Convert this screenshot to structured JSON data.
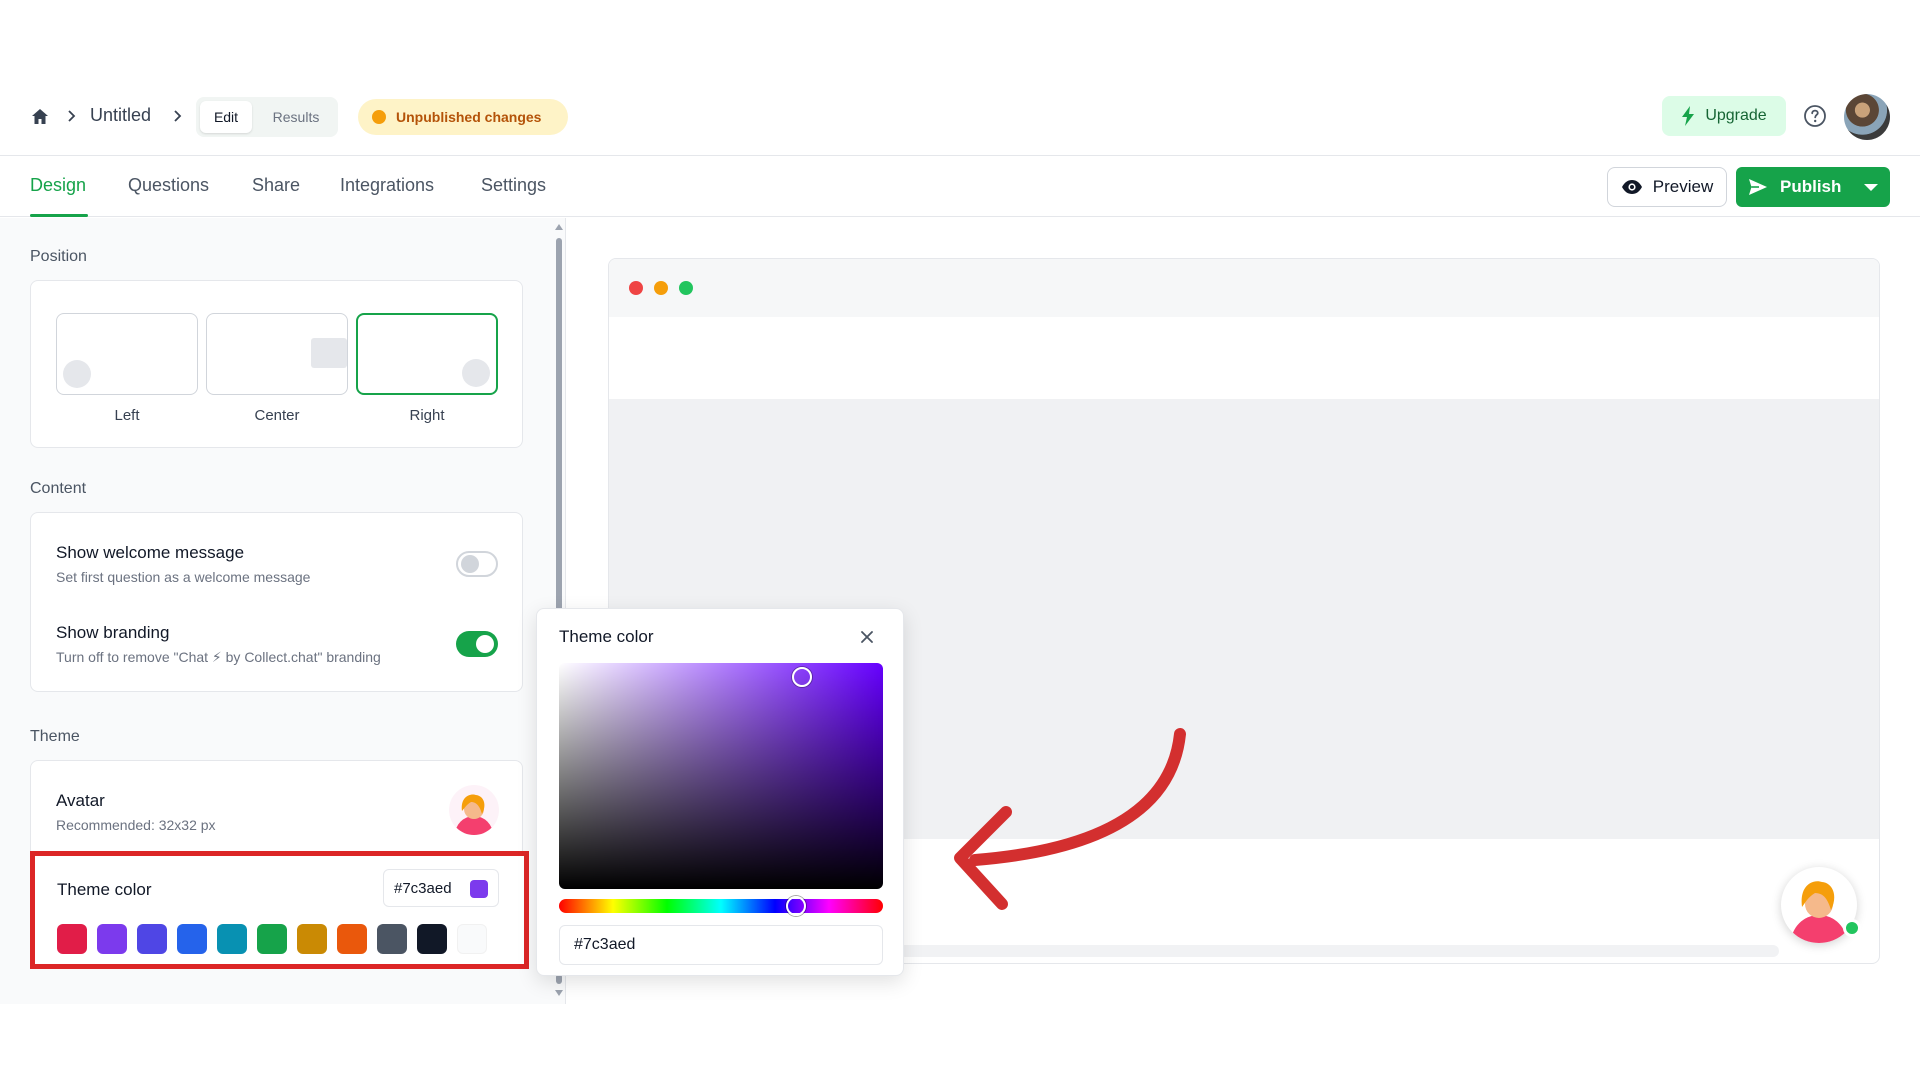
{
  "header": {
    "breadcrumb_title": "Untitled",
    "segment": {
      "edit": "Edit",
      "results": "Results"
    },
    "status_badge": "Unpublished changes",
    "upgrade_label": "Upgrade"
  },
  "tabs": [
    {
      "label": "Design",
      "active": true
    },
    {
      "label": "Questions"
    },
    {
      "label": "Share"
    },
    {
      "label": "Integrations"
    },
    {
      "label": "Settings"
    }
  ],
  "actions": {
    "preview_label": "Preview",
    "publish_label": "Publish"
  },
  "position": {
    "section_label": "Position",
    "options": [
      "Left",
      "Center",
      "Right"
    ],
    "selected": "Right"
  },
  "content": {
    "section_label": "Content",
    "welcome": {
      "title": "Show welcome message",
      "subtitle": "Set first question as a welcome message",
      "enabled": false
    },
    "branding": {
      "title": "Show branding",
      "subtitle": "Turn off to remove \"Chat ⚡ by Collect.chat\" branding",
      "enabled": true
    }
  },
  "theme": {
    "section_label": "Theme",
    "avatar": {
      "title": "Avatar",
      "subtitle": "Recommended: 32x32 px"
    },
    "theme_color": {
      "title": "Theme color",
      "value": "#7c3aed"
    },
    "swatches": [
      "#e11d48",
      "#7c3aed",
      "#4f46e5",
      "#2563eb",
      "#0891b2",
      "#16a34a",
      "#ca8a04",
      "#ea580c",
      "#4b5563",
      "#111827",
      "#f9fafb"
    ]
  },
  "picker": {
    "title": "Theme color",
    "value": "#7c3aed",
    "saturation": 0.75,
    "brightness": 0.94,
    "hue": 263
  },
  "colors": {
    "accent": "#16a34a",
    "highlight_box": "#dc2626",
    "annotation_arrow": "#d32f2f",
    "traffic_lights": [
      "#ef4444",
      "#f59e0b",
      "#22c55e"
    ]
  }
}
